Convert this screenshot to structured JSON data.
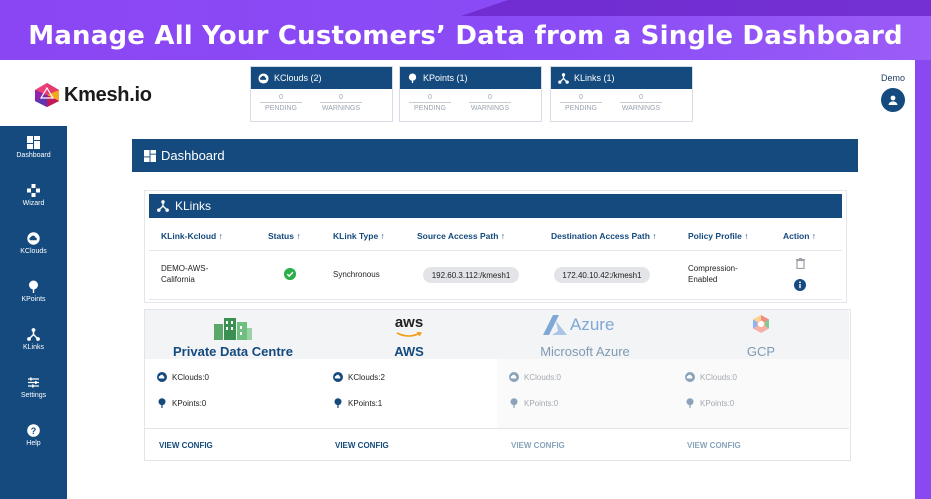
{
  "banner": {
    "title": "Manage All Your Customers’ Data from a Single Dashboard"
  },
  "colors": {
    "brand": "#144a7e",
    "banner": "#8a48f1",
    "success": "#2cae48"
  },
  "app": {
    "logo_text": "Kmesh.io",
    "user_label": "Demo"
  },
  "stats": [
    {
      "title": "KClouds (2)",
      "pending": "0",
      "pending_label": "PENDING",
      "warnings": "0",
      "warnings_label": "WARNINGS"
    },
    {
      "title": "KPoints (1)",
      "pending": "0",
      "pending_label": "PENDING",
      "warnings": "0",
      "warnings_label": "WARNINGS"
    },
    {
      "title": "KLinks (1)",
      "pending": "0",
      "pending_label": "PENDING",
      "warnings": "0",
      "warnings_label": "WARNINGS"
    }
  ],
  "sidebar": {
    "items": [
      {
        "label": "Dashboard",
        "icon": "dashboard-icon"
      },
      {
        "label": "Wizard",
        "icon": "wizard-icon"
      },
      {
        "label": "KClouds",
        "icon": "cloud-icon"
      },
      {
        "label": "KPoints",
        "icon": "pin-icon"
      },
      {
        "label": "KLinks",
        "icon": "link-icon"
      },
      {
        "label": "Settings",
        "icon": "settings-icon"
      },
      {
        "label": "Help",
        "icon": "help-icon"
      }
    ]
  },
  "dashboard": {
    "title": "Dashboard"
  },
  "klinks": {
    "title": "KLinks",
    "columns": [
      "KLink-Kcloud ↑",
      "Status ↑",
      "KLink Type ↑",
      "Source Access Path ↑",
      "Destination Access Path ↑",
      "Policy Profile ↑",
      "Action ↑"
    ],
    "rows": [
      {
        "kcloud_line1": "DEMO-AWS-",
        "kcloud_line2": "California",
        "type": "Synchronous",
        "source": "192.60.3.112:/kmesh1",
        "destination": "172.40.10.42:/kmesh1",
        "policy_line1": "Compression-",
        "policy_line2": "Enabled"
      }
    ]
  },
  "clouds": [
    {
      "name": "Private Data Centre",
      "kclouds": "KClouds:0",
      "kpoints": "KPoints:0",
      "action": "VIEW CONFIG",
      "logo": "building-icon"
    },
    {
      "name": "AWS",
      "logo_text": "aws",
      "kclouds": "KClouds:2",
      "kpoints": "KPoints:1",
      "action": "VIEW CONFIG",
      "logo": "aws-icon"
    },
    {
      "name": "Microsoft Azure",
      "logo_text": "Azure",
      "kclouds": "KClouds:0",
      "kpoints": "KPoints:0",
      "action": "VIEW CONFIG",
      "logo": "azure-icon"
    },
    {
      "name": "GCP",
      "kclouds": "KClouds:0",
      "kpoints": "KPoints:0",
      "action": "VIEW CONFIG",
      "logo": "gcp-icon"
    }
  ]
}
